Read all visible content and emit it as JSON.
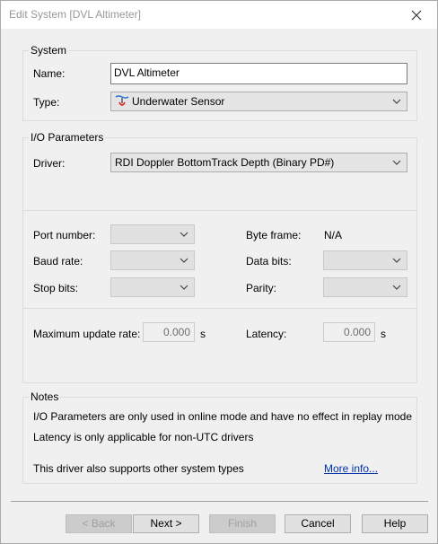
{
  "window": {
    "title": "Edit System [DVL Altimeter]"
  },
  "system": {
    "group_label": "System",
    "name_label": "Name:",
    "name_value": "DVL Altimeter",
    "type_label": "Type:",
    "type_value": "Underwater Sensor",
    "type_icon": "underwater-sensor-icon"
  },
  "io": {
    "group_label": "I/O Parameters",
    "driver_label": "Driver:",
    "driver_value": "RDI Doppler BottomTrack Depth (Binary PD#)",
    "port_label": "Port number:",
    "baud_label": "Baud rate:",
    "stop_label": "Stop bits:",
    "byte_frame_label": "Byte frame:",
    "byte_frame_value": "N/A",
    "data_bits_label": "Data bits:",
    "parity_label": "Parity:",
    "max_rate_label": "Maximum update rate:",
    "max_rate_value": "0.000",
    "max_rate_unit": "s",
    "latency_label": "Latency:",
    "latency_value": "0.000",
    "latency_unit": "s"
  },
  "notes": {
    "group_label": "Notes",
    "line1": "I/O Parameters are only used in online mode and have no effect in replay mode",
    "line2": "Latency is only applicable for non-UTC drivers",
    "line3": "This driver also supports other system types",
    "more_link": "More info..."
  },
  "buttons": {
    "back": "< Back",
    "next": "Next >",
    "finish": "Finish",
    "cancel": "Cancel",
    "help": "Help"
  }
}
